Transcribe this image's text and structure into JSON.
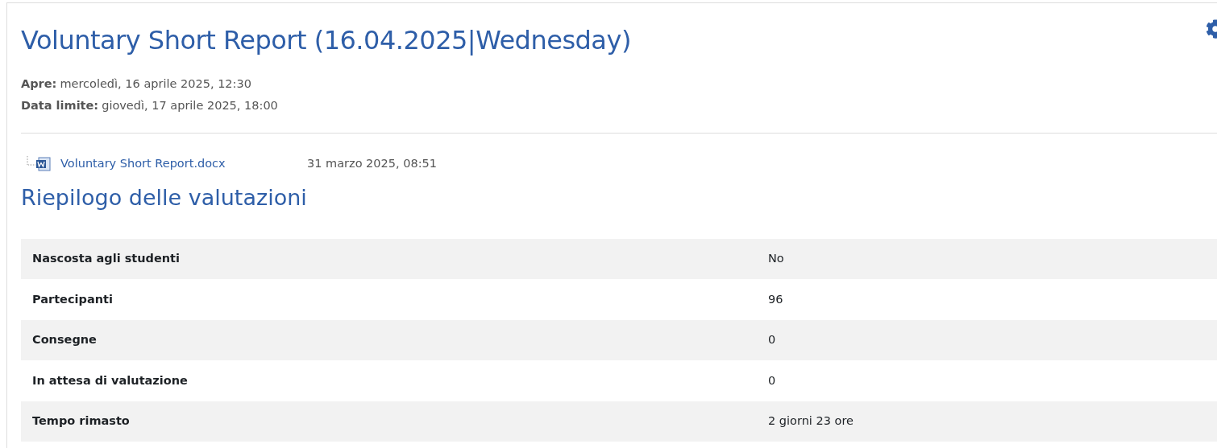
{
  "title": "Voluntary Short Report (16.04.2025|Wednesday)",
  "dates": [
    {
      "label": "Apre:",
      "value": "mercoledì, 16 aprile 2025, 12:30"
    },
    {
      "label": "Data limite:",
      "value": "giovedì, 17 aprile 2025, 18:00"
    }
  ],
  "file": {
    "name": "Voluntary Short Report.docx",
    "date": "31 marzo 2025, 08:51"
  },
  "summary": {
    "heading": "Riepilogo delle valutazioni",
    "rows": [
      {
        "label": "Nascosta agli studenti",
        "value": "No"
      },
      {
        "label": "Partecipanti",
        "value": "96"
      },
      {
        "label": "Consegne",
        "value": "0"
      },
      {
        "label": "In attesa di valutazione",
        "value": "0"
      },
      {
        "label": "Tempo rimasto",
        "value": "2 giorni 23 ore"
      }
    ]
  }
}
